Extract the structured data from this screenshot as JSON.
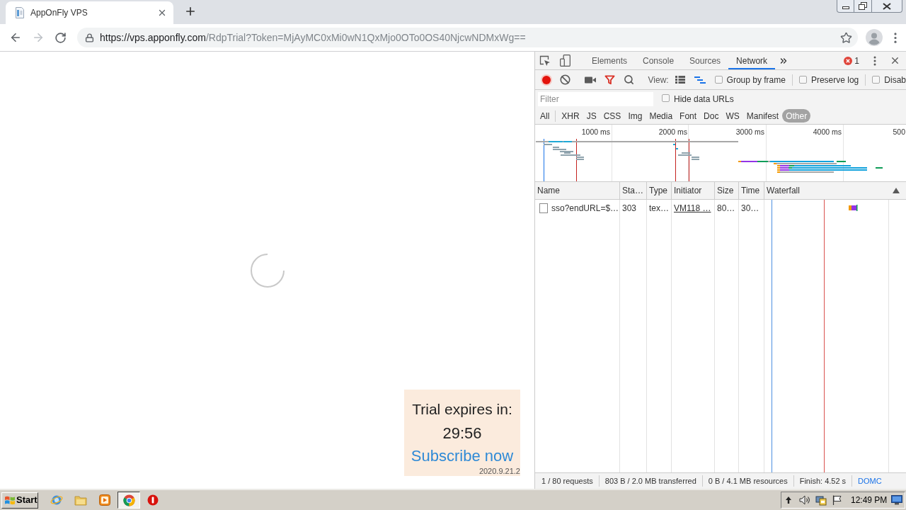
{
  "browser": {
    "tab": {
      "title": "AppOnFly VPS"
    },
    "nav": {
      "back_disabled": false,
      "forward_disabled": true
    },
    "address": {
      "host": "https://vps.apponfly.com",
      "path": "/RdpTrial?Token=MjAyMC0xMi0wN1QxMjo0OTo0OS40NjcwNDMxWg=="
    },
    "bookmarked": false
  },
  "page": {
    "loading": true,
    "trial": {
      "label": "Trial expires in:",
      "countdown": "29:56",
      "link": "Subscribe now",
      "version": "2020.9.21.2"
    }
  },
  "devtools": {
    "tabs": [
      {
        "label": "Elements",
        "selected": false
      },
      {
        "label": "Console",
        "selected": false
      },
      {
        "label": "Sources",
        "selected": false
      },
      {
        "label": "Network",
        "selected": true
      }
    ],
    "error_count": "1",
    "toolbar": {
      "recording": true,
      "view_label": "View:",
      "large_rows": false,
      "overview": true,
      "options": [
        {
          "label": "Group by frame",
          "checked": false
        },
        {
          "label": "Preserve log",
          "checked": false
        },
        {
          "label": "Disab",
          "checked": false
        }
      ]
    },
    "filter": {
      "placeholder": "Filter",
      "hide_data_urls": {
        "label": "Hide data URLs",
        "checked": false
      }
    },
    "types": [
      {
        "label": "All",
        "selected": false
      },
      {
        "label": "XHR",
        "selected": false
      },
      {
        "label": "JS",
        "selected": false
      },
      {
        "label": "CSS",
        "selected": false
      },
      {
        "label": "Img",
        "selected": false
      },
      {
        "label": "Media",
        "selected": false
      },
      {
        "label": "Font",
        "selected": false
      },
      {
        "label": "Doc",
        "selected": false
      },
      {
        "label": "WS",
        "selected": false
      },
      {
        "label": "Manifest",
        "selected": false
      },
      {
        "label": "Other",
        "selected": true
      }
    ],
    "overview": {
      "ticks": [
        "1000 ms",
        "2000 ms",
        "3000 ms",
        "4000 ms",
        "500"
      ]
    },
    "table": {
      "columns": [
        "Name",
        "Sta…",
        "Type",
        "Initiator",
        "Size",
        "Time",
        "Waterfall"
      ],
      "rows": [
        {
          "name": "sso?endURL=$…",
          "status": "303",
          "type": "tex…",
          "initiator": "VM118 …",
          "size": "80…",
          "time": "30…"
        }
      ]
    },
    "status_bar": [
      {
        "text": "1 / 80 requests",
        "color": "#333333"
      },
      {
        "text": "803 B / 2.0 MB transferred",
        "color": "#333333"
      },
      {
        "text": "0 B / 4.1 MB resources",
        "color": "#333333"
      },
      {
        "text": "Finish: 4.52 s",
        "color": "#333333"
      },
      {
        "text": "DOMC",
        "color": "#1a73e8"
      }
    ]
  },
  "taskbar": {
    "start": "Start",
    "apps": [
      {
        "kind": "globe",
        "selected": false
      },
      {
        "kind": "folder",
        "selected": false
      },
      {
        "kind": "player",
        "selected": false
      },
      {
        "kind": "browser",
        "selected": true
      },
      {
        "kind": "stop",
        "selected": false
      }
    ],
    "clock": "12:49 PM"
  }
}
